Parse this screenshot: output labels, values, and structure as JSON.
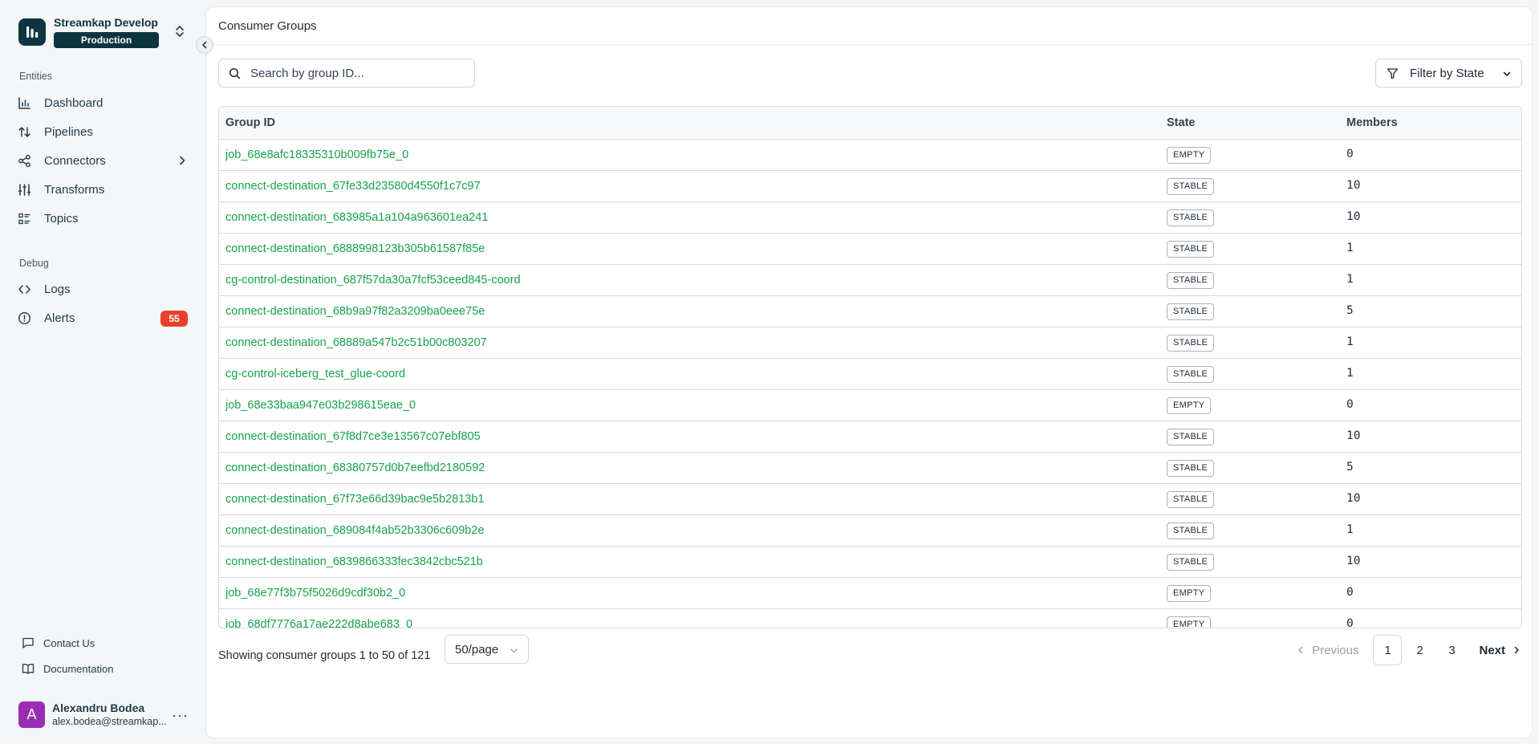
{
  "org": {
    "name": "Streamkap Develop",
    "environment": "Production"
  },
  "sidebar": {
    "sections": [
      {
        "label": "Entities"
      },
      {
        "label": "Debug"
      }
    ],
    "entities": [
      {
        "label": "Dashboard",
        "icon": "chart-icon"
      },
      {
        "label": "Pipelines",
        "icon": "arrows-icon"
      },
      {
        "label": "Connectors",
        "icon": "share-icon"
      },
      {
        "label": "Transforms",
        "icon": "sliders-icon"
      },
      {
        "label": "Topics",
        "icon": "list-icon"
      }
    ],
    "debug": [
      {
        "label": "Logs",
        "icon": "code-icon"
      },
      {
        "label": "Alerts",
        "icon": "alert-icon",
        "badge": "55"
      }
    ],
    "footer_links": [
      {
        "label": "Contact Us",
        "icon": "message-icon"
      },
      {
        "label": "Documentation",
        "icon": "book-icon"
      }
    ],
    "user": {
      "initial": "A",
      "name": "Alexandru Bodea",
      "email": "alex.bodea@streamkap..."
    }
  },
  "main": {
    "title": "Consumer Groups",
    "search": {
      "placeholder": "Search by group ID..."
    },
    "filter_label": "Filter by State",
    "table": {
      "headers": {
        "group_id": "Group ID",
        "state": "State",
        "members": "Members"
      },
      "rows": [
        {
          "group_id": "job_68e8afc18335310b009fb75e_0",
          "state": "EMPTY",
          "members": "0"
        },
        {
          "group_id": "connect-destination_67fe33d23580d4550f1c7c97",
          "state": "STABLE",
          "members": "10"
        },
        {
          "group_id": "connect-destination_683985a1a104a963601ea241",
          "state": "STABLE",
          "members": "10"
        },
        {
          "group_id": "connect-destination_6888998123b305b61587f85e",
          "state": "STABLE",
          "members": "1"
        },
        {
          "group_id": "cg-control-destination_687f57da30a7fcf53ceed845-coord",
          "state": "STABLE",
          "members": "1"
        },
        {
          "group_id": "connect-destination_68b9a97f82a3209ba0eee75e",
          "state": "STABLE",
          "members": "5"
        },
        {
          "group_id": "connect-destination_68889a547b2c51b00c803207",
          "state": "STABLE",
          "members": "1"
        },
        {
          "group_id": "cg-control-iceberg_test_glue-coord",
          "state": "STABLE",
          "members": "1"
        },
        {
          "group_id": "job_68e33baa947e03b298615eae_0",
          "state": "EMPTY",
          "members": "0"
        },
        {
          "group_id": "connect-destination_67f8d7ce3e13567c07ebf805",
          "state": "STABLE",
          "members": "10"
        },
        {
          "group_id": "connect-destination_68380757d0b7eefbd2180592",
          "state": "STABLE",
          "members": "5"
        },
        {
          "group_id": "connect-destination_67f73e66d39bac9e5b2813b1",
          "state": "STABLE",
          "members": "10"
        },
        {
          "group_id": "connect-destination_689084f4ab52b3306c609b2e",
          "state": "STABLE",
          "members": "1"
        },
        {
          "group_id": "connect-destination_6839866333fec3842cbc521b",
          "state": "STABLE",
          "members": "10"
        },
        {
          "group_id": "job_68e77f3b75f5026d9cdf30b2_0",
          "state": "EMPTY",
          "members": "0"
        },
        {
          "group_id": "job_68df7776a17ae222d8abe683_0",
          "state": "EMPTY",
          "members": "0"
        }
      ]
    },
    "footer": {
      "summary": "Showing consumer groups 1 to 50 of 121",
      "page_size": "50/page",
      "pagination": {
        "previous": "Previous",
        "pages": [
          "1",
          "2",
          "3"
        ],
        "current": "1",
        "next": "Next"
      }
    }
  },
  "colors": {
    "brand": "#0e3440",
    "link": "#16a34a",
    "alert": "#e8412b",
    "avatar": "#9b2db5"
  }
}
